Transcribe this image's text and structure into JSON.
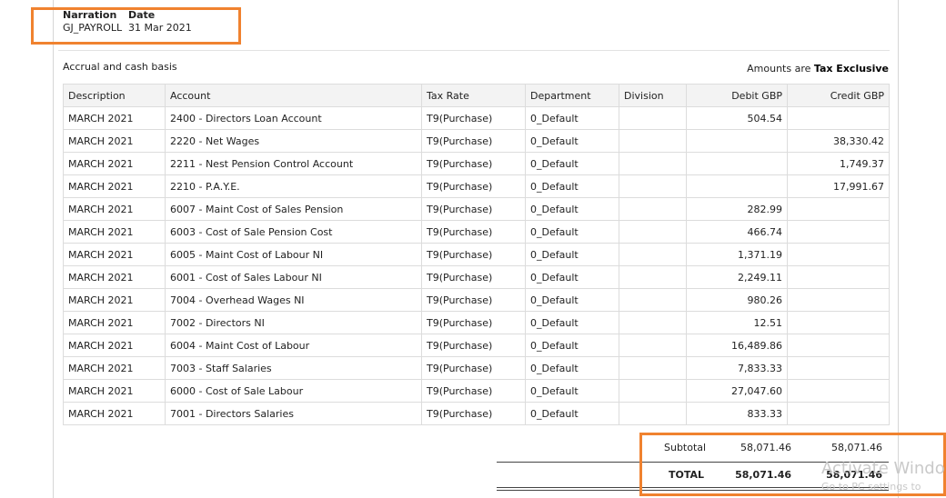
{
  "header": {
    "narration_label": "Narration",
    "narration_value": "GJ_PAYROLL",
    "date_label": "Date",
    "date_value": "31 Mar 2021"
  },
  "basis_text": "Accrual and cash basis",
  "amounts_prefix": "Amounts are",
  "amounts_mode": "Tax Exclusive",
  "columns": [
    "Description",
    "Account",
    "Tax Rate",
    "Department",
    "Division",
    "Debit GBP",
    "Credit GBP"
  ],
  "rows": [
    {
      "description": "MARCH 2021",
      "account": "2400 - Directors Loan Account",
      "tax_rate": "T9(Purchase)",
      "department": "0_Default",
      "division": "",
      "debit": "504.54",
      "credit": ""
    },
    {
      "description": "MARCH 2021",
      "account": "2220 - Net Wages",
      "tax_rate": "T9(Purchase)",
      "department": "0_Default",
      "division": "",
      "debit": "",
      "credit": "38,330.42"
    },
    {
      "description": "MARCH 2021",
      "account": "2211 - Nest Pension Control Account",
      "tax_rate": "T9(Purchase)",
      "department": "0_Default",
      "division": "",
      "debit": "",
      "credit": "1,749.37"
    },
    {
      "description": "MARCH 2021",
      "account": "2210 - P.A.Y.E.",
      "tax_rate": "T9(Purchase)",
      "department": "0_Default",
      "division": "",
      "debit": "",
      "credit": "17,991.67"
    },
    {
      "description": "MARCH 2021",
      "account": "6007 - Maint Cost of Sales Pension",
      "tax_rate": "T9(Purchase)",
      "department": "0_Default",
      "division": "",
      "debit": "282.99",
      "credit": ""
    },
    {
      "description": "MARCH 2021",
      "account": "6003 - Cost of Sale Pension Cost",
      "tax_rate": "T9(Purchase)",
      "department": "0_Default",
      "division": "",
      "debit": "466.74",
      "credit": ""
    },
    {
      "description": "MARCH 2021",
      "account": "6005 - Maint Cost of Labour NI",
      "tax_rate": "T9(Purchase)",
      "department": "0_Default",
      "division": "",
      "debit": "1,371.19",
      "credit": ""
    },
    {
      "description": "MARCH 2021",
      "account": "6001 - Cost of Sales Labour NI",
      "tax_rate": "T9(Purchase)",
      "department": "0_Default",
      "division": "",
      "debit": "2,249.11",
      "credit": ""
    },
    {
      "description": "MARCH 2021",
      "account": "7004 - Overhead Wages NI",
      "tax_rate": "T9(Purchase)",
      "department": "0_Default",
      "division": "",
      "debit": "980.26",
      "credit": ""
    },
    {
      "description": "MARCH 2021",
      "account": "7002 - Directors NI",
      "tax_rate": "T9(Purchase)",
      "department": "0_Default",
      "division": "",
      "debit": "12.51",
      "credit": ""
    },
    {
      "description": "MARCH 2021",
      "account": "6004 - Maint Cost of Labour",
      "tax_rate": "T9(Purchase)",
      "department": "0_Default",
      "division": "",
      "debit": "16,489.86",
      "credit": ""
    },
    {
      "description": "MARCH 2021",
      "account": "7003 - Staff Salaries",
      "tax_rate": "T9(Purchase)",
      "department": "0_Default",
      "division": "",
      "debit": "7,833.33",
      "credit": ""
    },
    {
      "description": "MARCH 2021",
      "account": "6000 - Cost of Sale Labour",
      "tax_rate": "T9(Purchase)",
      "department": "0_Default",
      "division": "",
      "debit": "27,047.60",
      "credit": ""
    },
    {
      "description": "MARCH 2021",
      "account": "7001 - Directors Salaries",
      "tax_rate": "T9(Purchase)",
      "department": "0_Default",
      "division": "",
      "debit": "833.33",
      "credit": ""
    }
  ],
  "totals": {
    "subtotal_label": "Subtotal",
    "subtotal_debit": "58,071.46",
    "subtotal_credit": "58,071.46",
    "total_label": "TOTAL",
    "total_debit": "58,071.46",
    "total_credit": "58,071.46"
  },
  "watermark": {
    "line1": "Activate Windo",
    "line2": "Go to PC settings to"
  },
  "colors": {
    "highlight": "#f0822f",
    "header_bg": "#f3f3f3",
    "grid_border": "#dcdcdc"
  }
}
